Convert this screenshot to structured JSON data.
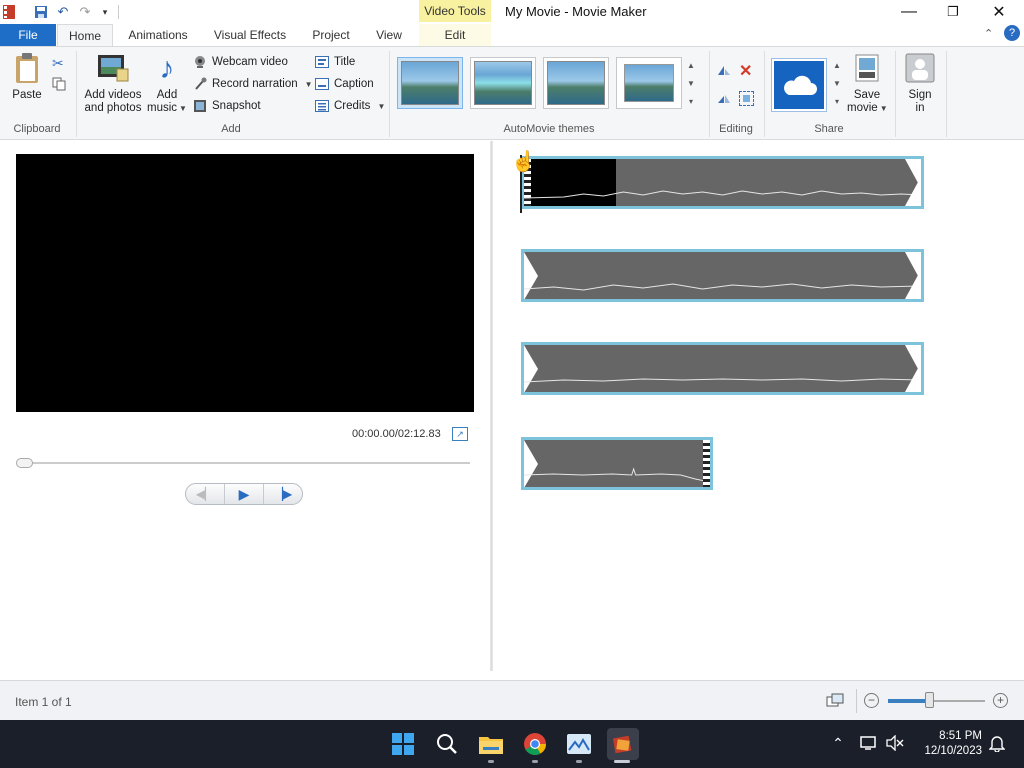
{
  "window": {
    "title": "My Movie - Movie Maker",
    "context_tab_title": "Video Tools",
    "controls": {
      "minimize": "—",
      "restore": "❐",
      "close": "✕"
    }
  },
  "tabs": [
    {
      "label": "File"
    },
    {
      "label": "Home"
    },
    {
      "label": "Animations"
    },
    {
      "label": "Visual Effects"
    },
    {
      "label": "Project"
    },
    {
      "label": "View"
    },
    {
      "label": "Edit"
    }
  ],
  "ribbon": {
    "clipboard": {
      "paste": "Paste",
      "group": "Clipboard"
    },
    "add": {
      "add_videos_line1": "Add videos",
      "add_videos_line2": "and photos",
      "add_music_line1": "Add",
      "add_music_line2": "music",
      "webcam": "Webcam video",
      "record_narration": "Record narration",
      "snapshot": "Snapshot",
      "title": "Title",
      "caption": "Caption",
      "credits": "Credits",
      "group": "Add"
    },
    "themes": {
      "group": "AutoMovie themes"
    },
    "editing": {
      "group": "Editing"
    },
    "share": {
      "save_line1": "Save",
      "save_line2": "movie",
      "group": "Share"
    },
    "signin": {
      "line1": "Sign",
      "line2": "in"
    }
  },
  "preview": {
    "time": "00:00.00/02:12.83",
    "seek_position": 0
  },
  "storyboard": {
    "clips": [
      {
        "type": "video-with-audio",
        "selected": true
      },
      {
        "type": "audio"
      },
      {
        "type": "audio"
      },
      {
        "type": "audio",
        "ends": true
      }
    ]
  },
  "status": {
    "text": "Item 1 of 1",
    "zoom_level": 0.42
  },
  "taskbar": {
    "time": "8:51 PM",
    "date": "12/10/2023"
  },
  "colors": {
    "file_tab": "#1e6ec8",
    "clip_border": "#7ec3dc",
    "context_tab": "#f7f1a0",
    "taskbar": "#1b1f2a"
  }
}
